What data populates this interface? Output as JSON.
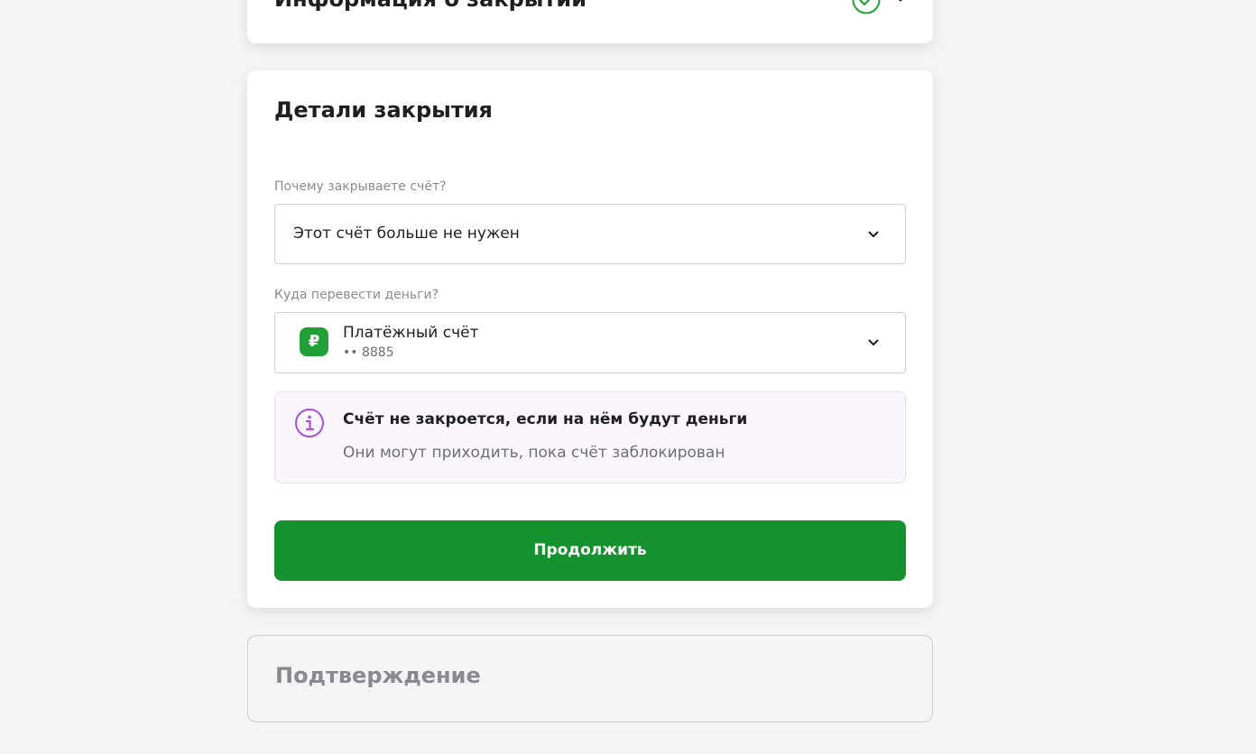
{
  "steps": {
    "closing_info": {
      "title": "Информация о закрытии"
    },
    "closing_details": {
      "heading": "Детали закрытия",
      "reason": {
        "label": "Почему закрываете счёт?",
        "value": "Этот счёт больше не нужен"
      },
      "transfer": {
        "label": "Куда перевести деньги?",
        "account_icon_symbol": "₽",
        "account_name": "Платёжный счёт",
        "account_number": "•• 8885"
      },
      "notice": {
        "title": "Счёт не закроется, если на нём будут деньги",
        "text": "Они могут приходить, пока счёт заблокирован"
      },
      "continue_label": "Продолжить"
    },
    "confirmation": {
      "title": "Подтверждение"
    }
  },
  "colors": {
    "primary_green": "#15922e",
    "account_icon_green": "#21a038",
    "info_purple": "#a94fd9",
    "check_green": "#21a038"
  },
  "icons": {
    "completed": "check-circle-icon",
    "expand": "chevron-down-icon",
    "info": "info-icon",
    "account": "ruble-icon"
  }
}
